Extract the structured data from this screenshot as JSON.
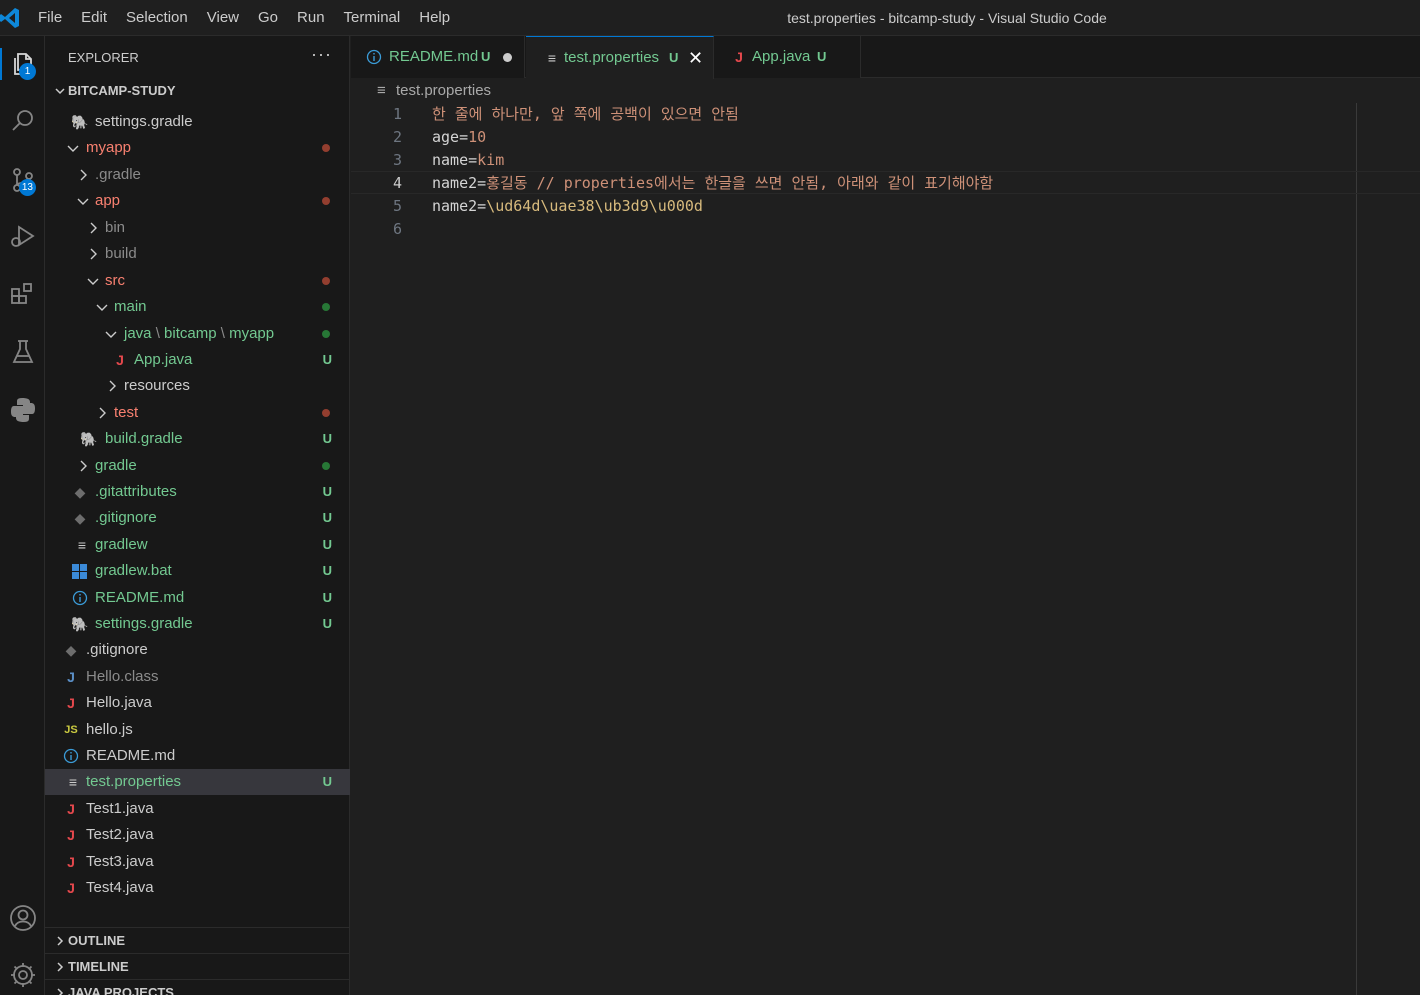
{
  "window": {
    "title": "test.properties - bitcamp-study - Visual Studio Code"
  },
  "menu": [
    "File",
    "Edit",
    "Selection",
    "View",
    "Go",
    "Run",
    "Terminal",
    "Help"
  ],
  "activity": {
    "explorer_badge": "1",
    "scm_badge": "13"
  },
  "sidebar": {
    "title": "EXPLORER",
    "more": "···",
    "root": "BITCAMP-STUDY",
    "tree": [
      {
        "label": "settings.gradle",
        "icon": "gradle-icon",
        "status": ""
      },
      {
        "label": "myapp",
        "icon": "folder",
        "status": "dot-red"
      },
      {
        "label": ".gradle",
        "icon": "folder",
        "status": ""
      },
      {
        "label": "app",
        "icon": "folder",
        "status": "dot-red"
      },
      {
        "label": "bin",
        "icon": "folder",
        "status": ""
      },
      {
        "label": "build",
        "icon": "folder",
        "status": ""
      },
      {
        "label": "src",
        "icon": "folder",
        "status": "dot-red"
      },
      {
        "label": "main",
        "icon": "folder",
        "status": "dot-green"
      },
      {
        "label": "java",
        "label2": "bitcamp",
        "label3": "myapp",
        "icon": "folder",
        "status": "dot-green"
      },
      {
        "label": "App.java",
        "icon": "java-icon",
        "status": "U"
      },
      {
        "label": "resources",
        "icon": "folder",
        "status": ""
      },
      {
        "label": "test",
        "icon": "folder",
        "status": "dot-red"
      },
      {
        "label": "build.gradle",
        "icon": "gradle-icon",
        "status": "U"
      },
      {
        "label": "gradle",
        "icon": "folder",
        "status": "dot-green"
      },
      {
        "label": ".gitattributes",
        "icon": "git-icon",
        "status": "U"
      },
      {
        "label": ".gitignore",
        "icon": "git-icon",
        "status": "U"
      },
      {
        "label": "gradlew",
        "icon": "lines-icon",
        "status": "U"
      },
      {
        "label": "gradlew.bat",
        "icon": "windows-icon",
        "status": "U"
      },
      {
        "label": "README.md",
        "icon": "info-icon",
        "status": "U"
      },
      {
        "label": "settings.gradle",
        "icon": "gradle-icon",
        "status": "U"
      },
      {
        "label": ".gitignore",
        "icon": "git-icon",
        "status": ""
      },
      {
        "label": "Hello.class",
        "icon": "java-icon",
        "status": ""
      },
      {
        "label": "Hello.java",
        "icon": "java-icon",
        "status": ""
      },
      {
        "label": "hello.js",
        "icon": "js-icon",
        "status": ""
      },
      {
        "label": "README.md",
        "icon": "info-icon",
        "status": ""
      },
      {
        "label": "test.properties",
        "icon": "lines-icon",
        "status": "U"
      },
      {
        "label": "Test1.java",
        "icon": "java-icon",
        "status": ""
      },
      {
        "label": "Test2.java",
        "icon": "java-icon",
        "status": ""
      },
      {
        "label": "Test3.java",
        "icon": "java-icon",
        "status": ""
      },
      {
        "label": "Test4.java",
        "icon": "java-icon",
        "status": ""
      }
    ],
    "sections": [
      "OUTLINE",
      "TIMELINE",
      "JAVA PROJECTS"
    ]
  },
  "tabs": [
    {
      "label": "README.md",
      "status": "U",
      "state": "modified"
    },
    {
      "label": "test.properties",
      "status": "U",
      "state": "active"
    },
    {
      "label": "App.java",
      "status": "U",
      "state": ""
    }
  ],
  "breadcrumb": "test.properties",
  "editor": {
    "current_line": 4,
    "lines": [
      {
        "n": "1",
        "key": "",
        "sep": "",
        "value": "한 줄에 하나만, 앞 쪽에 공백이 있으면 안됨"
      },
      {
        "n": "2",
        "key": "age",
        "sep": "=",
        "value": "10"
      },
      {
        "n": "3",
        "key": "name",
        "sep": "=",
        "value": "kim"
      },
      {
        "n": "4",
        "key": "name2",
        "sep": "=",
        "value": "홍길동 // properties에서는 한글을 쓰면 안됨, 아래와 같이 표기해야함"
      },
      {
        "n": "5",
        "key": "name2",
        "sep": "=",
        "value": "\\ud64d\\uae38\\ub3d9\\u000d"
      },
      {
        "n": "6",
        "key": "",
        "sep": "",
        "value": ""
      }
    ]
  },
  "colors": {
    "accent": "#0078d4",
    "untracked": "#73c991",
    "modified_dot": "#c74e39",
    "added_dot": "#2ea043",
    "error_text": "#f88070"
  }
}
